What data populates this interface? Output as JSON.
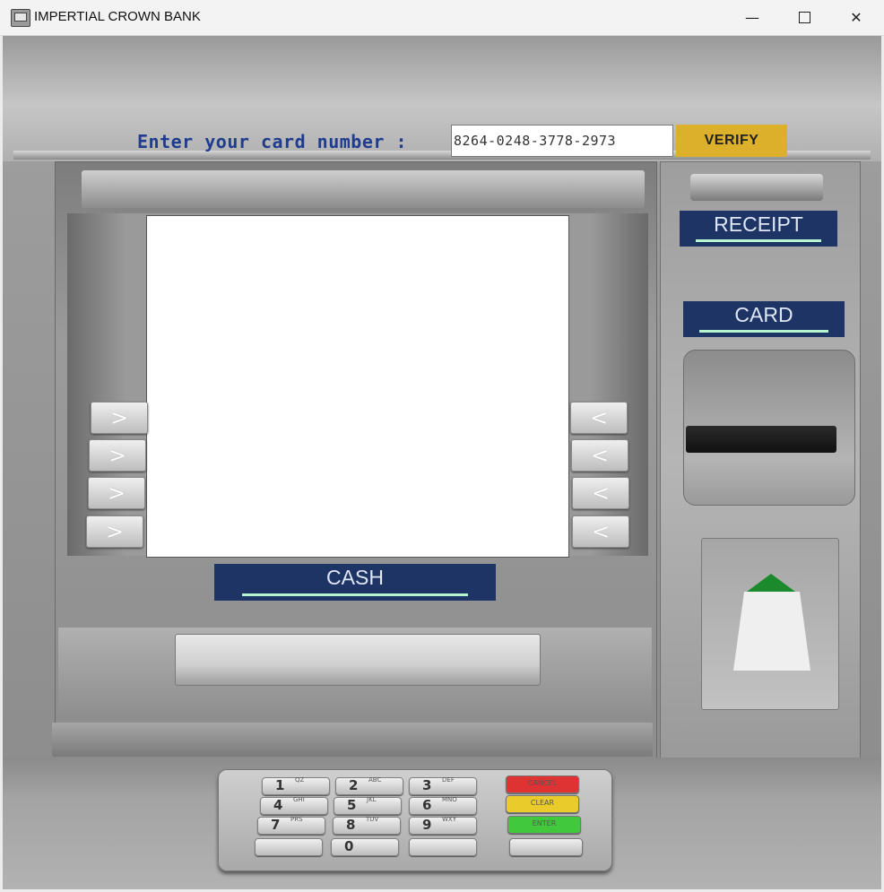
{
  "window": {
    "title": "IMPERTIAL CROWN BANK",
    "icon": "atm-icon",
    "controls": {
      "minimize": "—",
      "maximize": "",
      "close": "✕"
    }
  },
  "card_entry": {
    "prompt": "Enter your card number :",
    "card_number": "8264-0248-3778-2973",
    "verify_label": "VERIFY"
  },
  "labels": {
    "receipt": "RECEIPT",
    "card": "CARD",
    "cash": "CASH"
  },
  "side_buttons": {
    "left": [
      ">",
      ">",
      ">",
      ">"
    ],
    "right": [
      "<",
      "<",
      "<",
      "<"
    ]
  },
  "keypad": {
    "keys": [
      {
        "num": "1",
        "sub": "QZ"
      },
      {
        "num": "2",
        "sub": "ABC"
      },
      {
        "num": "3",
        "sub": "DEF"
      },
      {
        "num": "4",
        "sub": "GHI"
      },
      {
        "num": "5",
        "sub": "JKL"
      },
      {
        "num": "6",
        "sub": "MNO"
      },
      {
        "num": "7",
        "sub": "PRS"
      },
      {
        "num": "8",
        "sub": "TUV"
      },
      {
        "num": "9",
        "sub": "WXY"
      },
      {
        "num": "",
        "sub": ""
      },
      {
        "num": "0",
        "sub": ""
      },
      {
        "num": "",
        "sub": ""
      }
    ],
    "function_keys": [
      "CANCEL",
      "CLEAR",
      "ENTER",
      ""
    ]
  },
  "colors": {
    "prompt_text": "#1f3c8f",
    "verify_button": "#ddb02b",
    "label_background": "#1d3464",
    "label_stripe": "#b6f3cf",
    "cancel_key": "#df3333",
    "clear_key": "#eacb2c",
    "enter_key": "#42c83c"
  }
}
